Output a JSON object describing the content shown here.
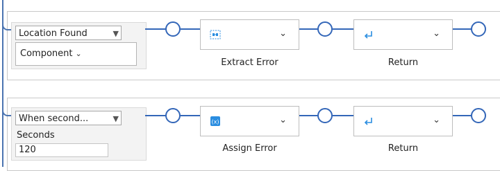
{
  "rules": [
    {
      "condition_select": "Location Found",
      "component_select": "Component",
      "actions": [
        {
          "label": "Extract Error",
          "icon": "extract-icon"
        },
        {
          "label": "Return",
          "icon": "return-arrow-icon"
        }
      ]
    },
    {
      "condition_select": "When second...",
      "field_label": "Seconds",
      "field_value": "120",
      "actions": [
        {
          "label": "Assign Error",
          "icon": "variable-icon"
        },
        {
          "label": "Return",
          "icon": "return-arrow-icon"
        }
      ]
    }
  ],
  "colors": {
    "connector": "#3366b8",
    "rail": "#4a73b0",
    "icon": "#2a8de0"
  }
}
